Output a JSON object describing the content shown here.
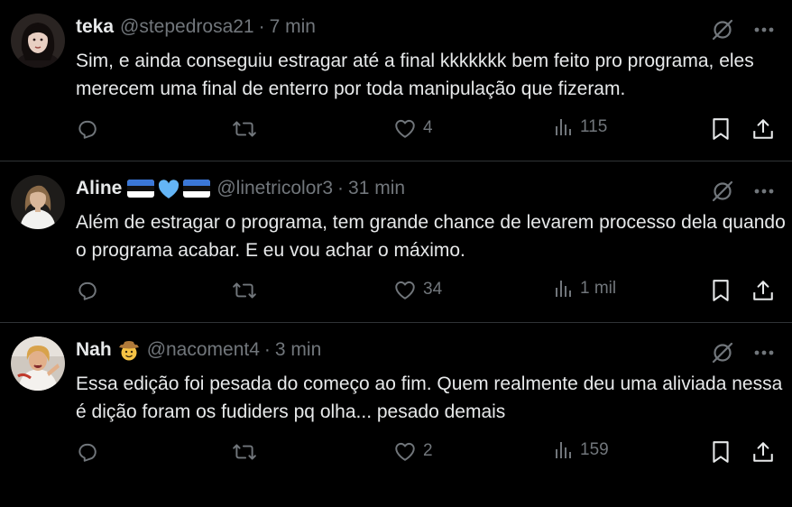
{
  "tweets": [
    {
      "name": "teka",
      "emoji": "",
      "handle": "@stepedrosa21",
      "separator": "·",
      "time": "7 min",
      "text": "Sim, e ainda conseguiu estragar até a final kkkkkkk bem feito pro programa, eles merecem uma final de enterro por toda manipulação que fizeram.",
      "likes": "4",
      "views": "115"
    },
    {
      "name": "Aline",
      "emoji": "flag-heart-flag",
      "handle": "@linetricolor3",
      "separator": "·",
      "time": "31 min",
      "text": "Além de estragar o programa, tem grande chance de levarem processo dela quando o programa acabar. E eu vou achar o máximo.",
      "likes": "34",
      "views": "1 mil"
    },
    {
      "name": "Nah",
      "emoji": "cowboy-face",
      "handle": "@nacoment4",
      "separator": "·",
      "time": "3 min",
      "text": "Essa edição foi pesada do começo ao fim. Quem realmente deu uma aliviada nessa é dição foram os fudiders pq olha... pesado demais",
      "likes": "2",
      "views": "159"
    }
  ],
  "icons": {
    "grok": "grok-slash-icon",
    "more": "more-dots-icon",
    "reply": "reply-icon",
    "retweet": "retweet-icon",
    "like": "heart-icon",
    "views": "views-bar-icon",
    "bookmark": "bookmark-icon",
    "share": "share-icon"
  },
  "colors": {
    "background": "#000000",
    "text": "#e7e9ea",
    "muted": "#71767b",
    "divider": "#2f3336"
  }
}
